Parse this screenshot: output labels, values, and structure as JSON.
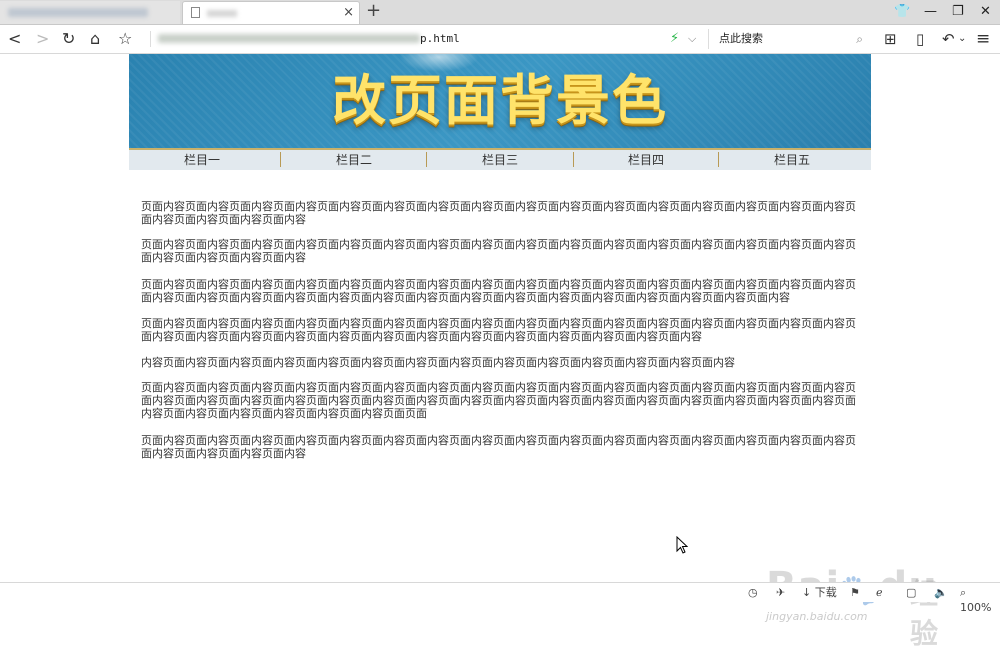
{
  "tabs": {
    "new_tab_symbol": "+",
    "close_symbol": "×"
  },
  "window_controls": {
    "skin": "👕",
    "minimize": "—",
    "restore": "❐",
    "close": "✕"
  },
  "toolbar": {
    "back": "<",
    "forward": ">",
    "refresh": "↻",
    "home": "⌂",
    "favorite": "☆",
    "url_visible_part": "p.html",
    "search_placeholder": "点此搜索",
    "apps": "⊞",
    "reader": "▯",
    "undo": "↶",
    "undo_chevron": "⌄",
    "menu": "≡"
  },
  "page": {
    "banner_title": "改页面背景色",
    "nav_items": [
      "栏目一",
      "栏目二",
      "栏目三",
      "栏目四",
      "栏目五"
    ],
    "paragraphs": [
      "页面内容页面内容页面内容页面内容页面内容页面内容页面内容页面内容页面内容页面内容页面内容页面内容页面内容页面内容页面内容页面内容页面内容页面内容页面内容页面内容",
      "页面内容页面内容页面内容页面内容页面内容页面内容页面内容页面内容页面内容页面内容页面内容页面内容页面内容页面内容页面内容页面内容页面内容页面内容页面内容页面内容",
      "页面内容页面内容页面内容页面内容页面内容页面内容页面内容页面内容页面内容页面内容页面内容页面内容页面内容页面内容页面内容页面内容页面内容页面内容页面内容页面内容页面内容页面内容页面内容页面内容页面内容页面内容页面内容页面内容页面内容页面内容页面内容",
      "页面内容页面内容页面内容页面内容页面内容页面内容页面内容页面内容页面内容页面内容页面内容页面内容页面内容页面内容页面内容页面内容页面内容页面内容页面内容页面内容页面内容页面内容页面内容页面内容页面内容页面内容页面内容页面内容页面内容",
      "内容页面内容页面内容页面内容页面内容页面内容页面内容页面内容页面内容页面内容页面内容页面内容页面内容页面内容",
      "页面内容页面内容页面内容页面内容页面内容页面内容页面内容页面内容页面内容页面内容页面内容页面内容页面内容页面内容页面内容页面内容页面内容页面内容页面内容页面内容页面内容页面内容页面内容页面内容页面内容页面内容页面内容页面内容页面内容页面内容页面内容页面内容页面内容页面内容页面内容页面内容页面内容页面内容页面页面",
      "页面内容页面内容页面内容页面内容页面内容页面内容页面内容页面内容页面内容页面内容页面内容页面内容页面内容页面内容页面内容页面内容页面内容页面内容页面内容页面内容"
    ]
  },
  "statusbar": {
    "download_label": "下载",
    "zoom": "100%"
  },
  "watermark": {
    "brand": "Bai",
    "brand2": "du",
    "cn": "经验",
    "url": "jingyan.baidu.com"
  },
  "colors": {
    "banner_bg": "#3b97c4",
    "banner_title": "#ffe36a",
    "nav_bg": "#e2e9ee",
    "nav_border": "#c9b16a",
    "secure_bolt": "#2db84d"
  }
}
